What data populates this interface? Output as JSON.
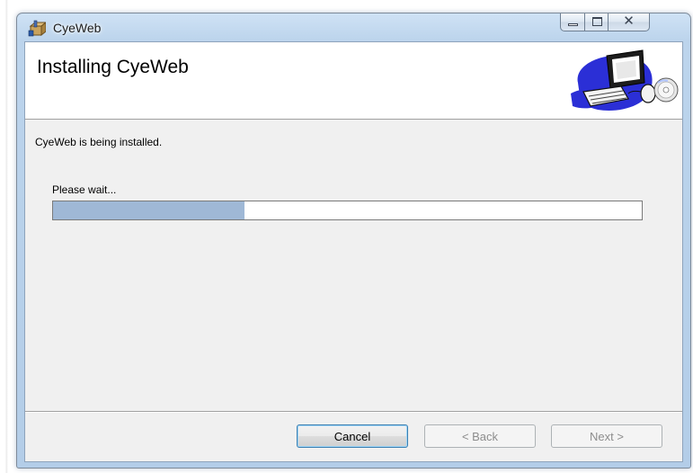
{
  "window": {
    "title": "CyeWeb",
    "app_icon": "installer-box-icon",
    "controls": {
      "minimize_icon": "minimize-icon",
      "maximize_icon": "maximize-icon",
      "close_icon": "close-icon",
      "close_glyph": "✕"
    }
  },
  "banner": {
    "title": "Installing CyeWeb",
    "graphic": "computer-setup-icon"
  },
  "body": {
    "status": "CyeWeb is being installed.",
    "wait_label": "Please wait...",
    "progress_fraction": 0.325
  },
  "buttons": {
    "cancel": "Cancel",
    "back": "< Back",
    "next": "Next >"
  },
  "colors": {
    "progress_fill": "#9fb8d6",
    "titlebar": "#bcd4ec",
    "dialog_background": "#f0f0f0"
  }
}
